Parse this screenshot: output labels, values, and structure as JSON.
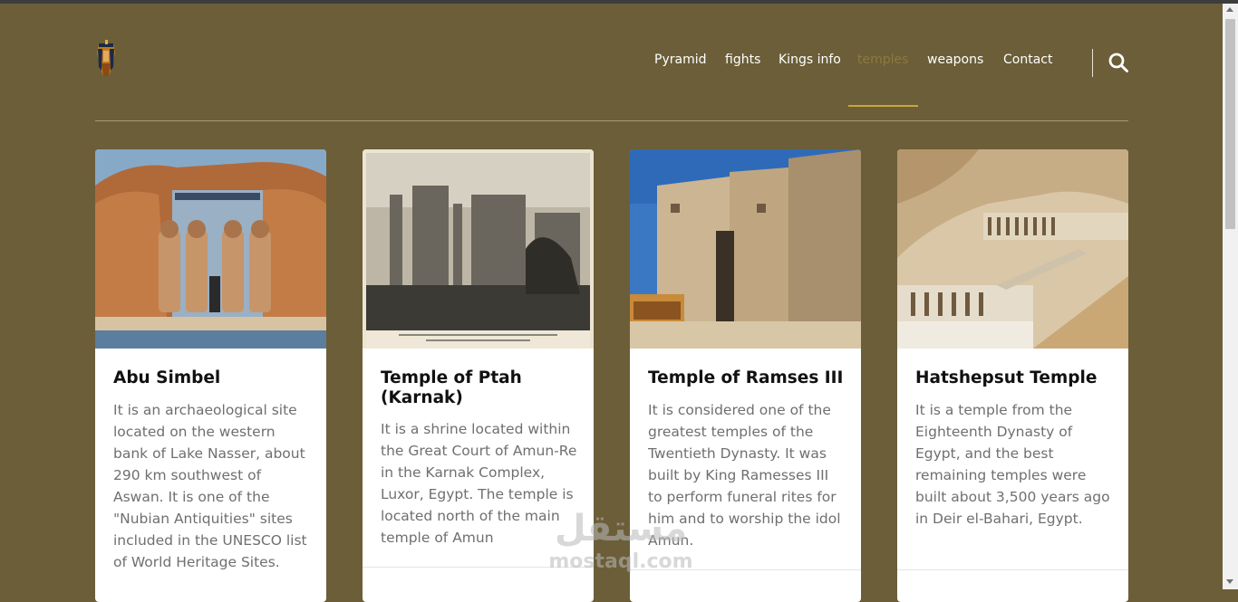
{
  "header": {
    "logo_icon": "pharaoh-logo-icon",
    "nav": [
      {
        "label": "Pyramid",
        "active": false
      },
      {
        "label": "fights",
        "active": false
      },
      {
        "label": "Kings info",
        "active": false
      },
      {
        "label": "temples",
        "active": true
      },
      {
        "label": "weapons",
        "active": false
      },
      {
        "label": "Contact",
        "active": false
      }
    ],
    "search_icon": "search-icon"
  },
  "cards": [
    {
      "title": "Abu Simbel",
      "text": "It is an archaeological site located on the western bank of Lake Nasser, about 290 km southwest of Aswan. It is one of the \"Nubian Antiquities\" sites included in the UNESCO list of World Heritage Sites."
    },
    {
      "title": "Temple of Ptah (Karnak)",
      "text": "It is a shrine located within the Great Court of Amun-Re in the Karnak Complex, Luxor, Egypt. The temple is located north of the main temple of Amun"
    },
    {
      "title": "Temple of Ramses III",
      "text": "It is considered one of the greatest temples of the Twentieth Dynasty. It was built by King Ramesses III to perform funeral rites for him and to worship the idol Amun."
    },
    {
      "title": "Hatshepsut Temple",
      "text": "It is a temple from the Eighteenth Dynasty of Egypt, and the best remaining temples were built about 3,500 years ago in Deir el-Bahari, Egypt."
    }
  ],
  "watermark": {
    "arabic": "مستقل",
    "latin": "mostaql.com"
  },
  "colors": {
    "background": "#6b5e38",
    "accent": "#c9a53c",
    "active_nav": "#8c7a3f"
  }
}
